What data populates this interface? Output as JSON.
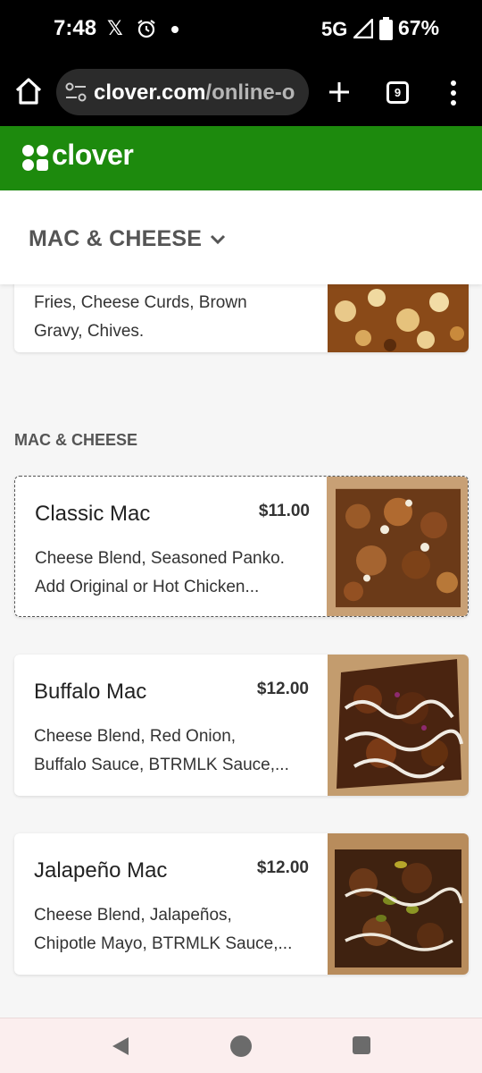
{
  "status_bar": {
    "time": "7:48",
    "x_glyph": "𝕏",
    "network": "5G",
    "battery": "67%"
  },
  "browser": {
    "url_host": "clover.com",
    "url_path": "/online-o"
  },
  "tabs_count": "9",
  "brand": {
    "name": "clover",
    "color": "#1d8a0d"
  },
  "category_selector": {
    "label": "MAC & CHEESE"
  },
  "previous_item": {
    "desc_line1": "Fries, Cheese Curds, Brown",
    "desc_line2": "Gravy, Chives."
  },
  "section": {
    "title": "MAC & CHEESE",
    "items": [
      {
        "name": "Classic Mac",
        "price": "$11.00",
        "desc_line1": "Cheese Blend, Seasoned Panko.",
        "desc_line2": "Add Original or Hot Chicken..."
      },
      {
        "name": "Buffalo Mac",
        "price": "$12.00",
        "desc_line1": "Cheese Blend, Red Onion,",
        "desc_line2": "Buffalo Sauce, BTRMLK Sauce,..."
      },
      {
        "name": "Jalapeño Mac",
        "price": "$12.00",
        "desc_line1": "Cheese Blend, Jalapeños,",
        "desc_line2": "Chipotle Mayo, BTRMLK Sauce,..."
      }
    ]
  }
}
